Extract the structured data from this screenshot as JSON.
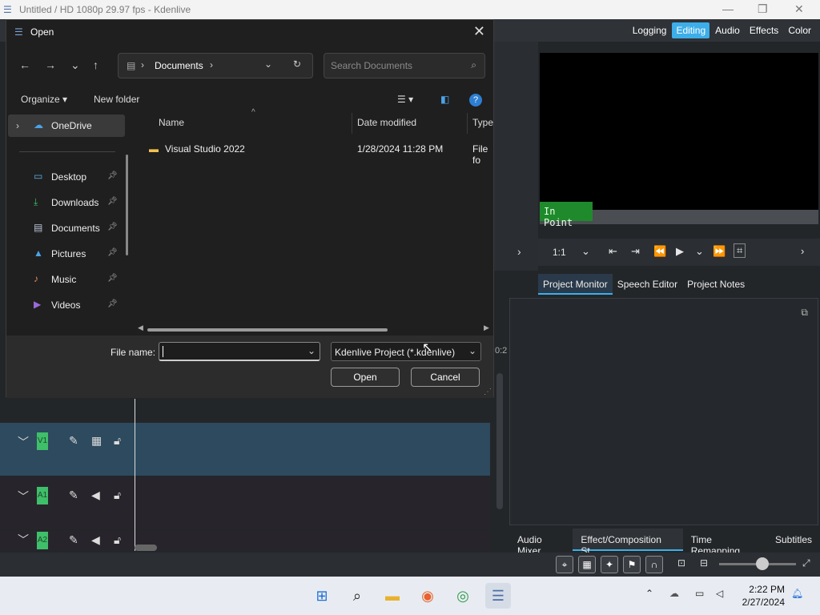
{
  "window": {
    "title": "Untitled / HD 1080p 29.97 fps - Kdenlive",
    "minimize_glyph": "—",
    "maximize_glyph": "❐",
    "close_glyph": "✕"
  },
  "layout_tabs": [
    {
      "label": "Logging"
    },
    {
      "label": "Editing"
    },
    {
      "label": "Audio"
    },
    {
      "label": "Effects"
    },
    {
      "label": "Color"
    }
  ],
  "monitor": {
    "in_point_label": "In Point",
    "zoom": "1:1",
    "tabs": [
      {
        "label": "Project Monitor"
      },
      {
        "label": "Speech Editor"
      },
      {
        "label": "Project Notes"
      }
    ]
  },
  "bottom_tabs": [
    {
      "label": "Audio Mixer"
    },
    {
      "label": "Effect/Composition St..."
    },
    {
      "label": "Time Remapping"
    },
    {
      "label": "Subtitles"
    }
  ],
  "tracks": [
    {
      "label": "V1"
    },
    {
      "label": "A1"
    },
    {
      "label": "A2"
    }
  ],
  "dialog": {
    "title": "Open",
    "breadcrumb": "Documents",
    "search_placeholder": "Search Documents",
    "organize_label": "Organize",
    "new_folder_label": "New folder",
    "nav_items": [
      {
        "label": "OneDrive"
      },
      {
        "label": "Desktop"
      },
      {
        "label": "Downloads"
      },
      {
        "label": "Documents"
      },
      {
        "label": "Pictures"
      },
      {
        "label": "Music"
      },
      {
        "label": "Videos"
      }
    ],
    "columns": {
      "name": "Name",
      "date": "Date modified",
      "type": "Type"
    },
    "files": [
      {
        "name": "Visual Studio 2022",
        "date": "1/28/2024 11:28 PM",
        "type": "File fo"
      }
    ],
    "file_name_label": "File name:",
    "file_name_value": "",
    "filter": "Kdenlive Project (*.kdenlive)",
    "open_label": "Open",
    "cancel_label": "Cancel"
  },
  "taskbar": {
    "time": "2:22 PM",
    "date": "2/27/2024"
  },
  "colors": {
    "accent": "#3daee9",
    "in_point_bg": "#1f8a2b",
    "dialog_bg": "#1f1f1f",
    "track_label": "#3fbf6a"
  }
}
